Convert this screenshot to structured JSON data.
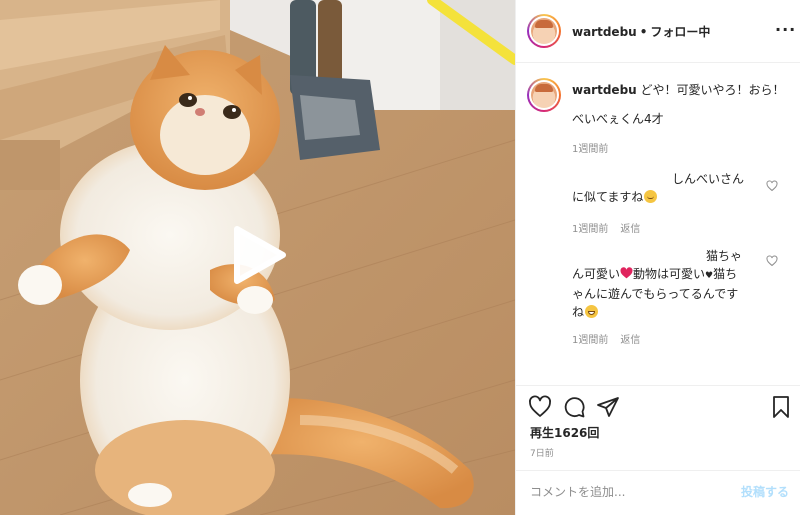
{
  "header": {
    "username": "wartdebu",
    "separator": "•",
    "follow_status": "フォロー中",
    "more_icon": "more-horizontal-icon"
  },
  "caption": {
    "username": "wartdebu",
    "text": "どや！可愛いやろ！おら！",
    "line2": "べいべぇくん4才",
    "time": "1週間前"
  },
  "comments": [
    {
      "line1": "しんべいさん",
      "line2": "に似てますね",
      "emoji": "smile-emoji",
      "time": "1週間前",
      "reply_label": "返信"
    },
    {
      "line1": "猫ちゃ",
      "line2a": "ん可愛い",
      "line2b": "動物は可愛い",
      "line2c": "猫ち",
      "line3": "ゃんに遊んでもらってるんです",
      "line4": "ね",
      "time": "1週間前",
      "reply_label": "返信"
    }
  ],
  "actions": {
    "like_icon": "heart-icon",
    "comment_icon": "comment-icon",
    "share_icon": "paper-plane-icon",
    "save_icon": "bookmark-icon",
    "views_label": "再生1626回",
    "time_ago": "7日前"
  },
  "comment_box": {
    "placeholder": "コメントを追加...",
    "post_label": "投稿する"
  },
  "colors": {
    "accent": "#0095f6",
    "post_disabled": "#b2dffc",
    "meta": "#8e8e8e",
    "heart_red": "#e0245e"
  }
}
